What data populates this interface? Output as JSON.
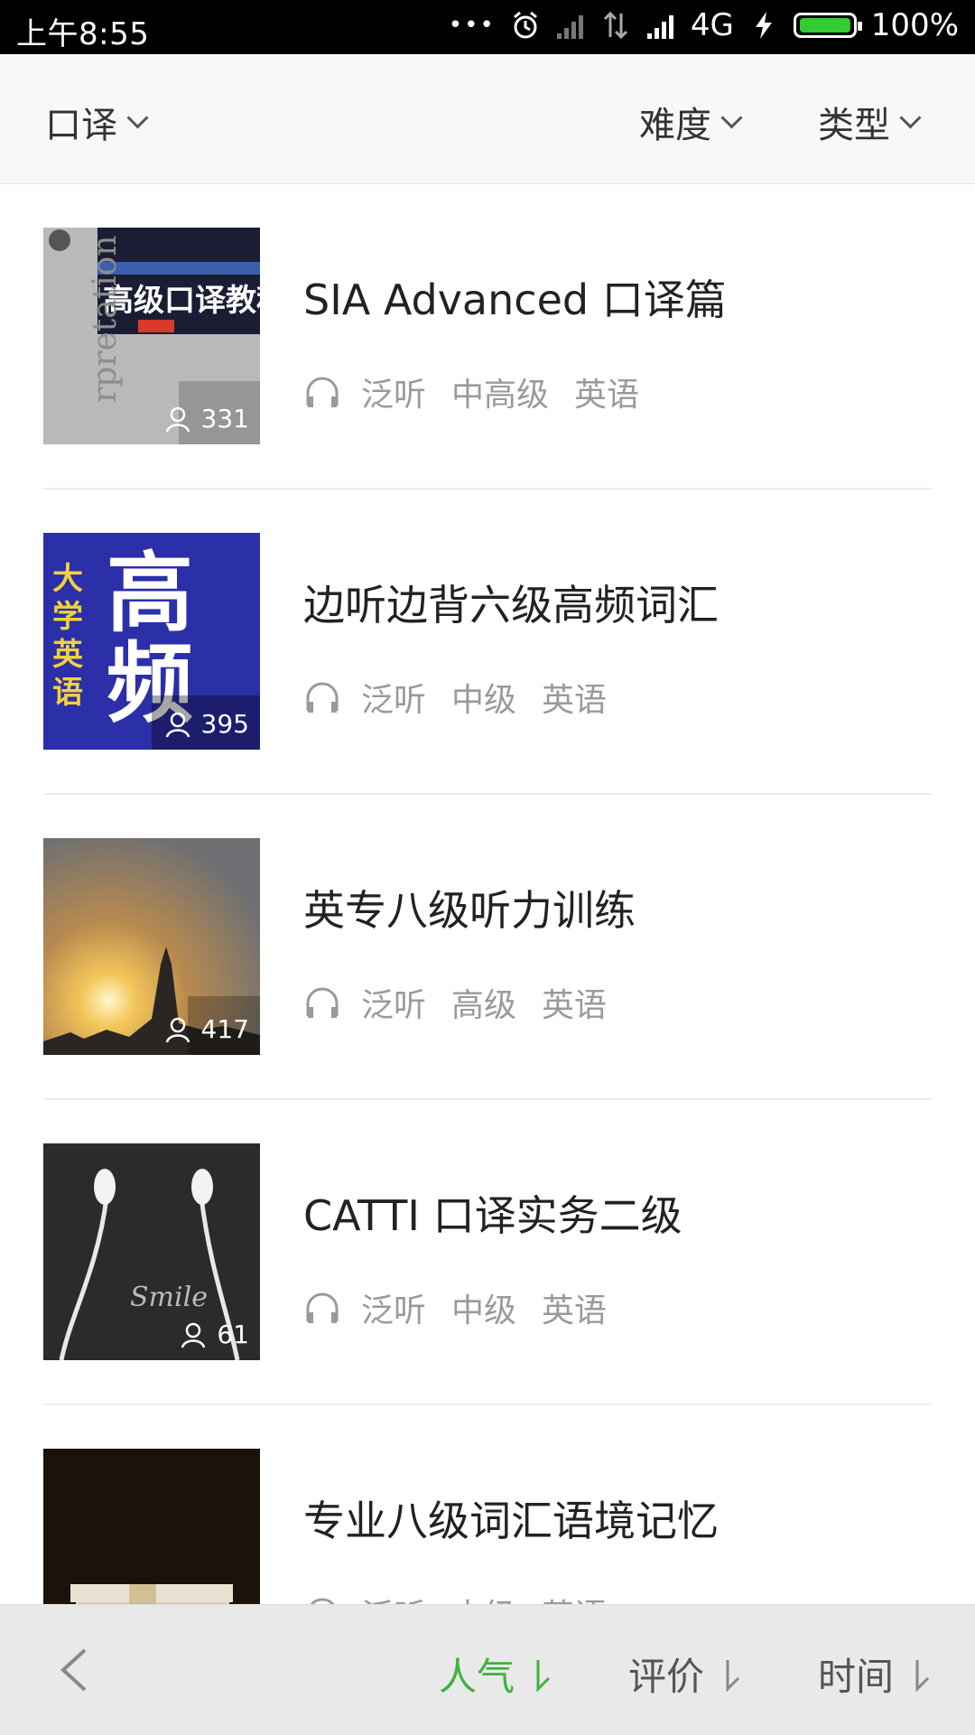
{
  "status": {
    "time": "上午8:55",
    "network": "4G",
    "battery": "100%",
    "battery_color": "#33cc33"
  },
  "filters": {
    "category": "口译",
    "difficulty": "难度",
    "type": "类型"
  },
  "items": [
    {
      "title": "SIA Advanced 口译篇",
      "count": "331",
      "tags": [
        "泛听",
        "中高级",
        "英语"
      ],
      "cover": "book-cover-advanced-interpretation"
    },
    {
      "title": "边听边背六级高频词汇",
      "count": "395",
      "tags": [
        "泛听",
        "中级",
        "英语"
      ],
      "cover": "book-cover-cet6-vocabulary"
    },
    {
      "title": "英专八级听力训练",
      "count": "417",
      "tags": [
        "泛听",
        "高级",
        "英语"
      ],
      "cover": "sunset-skyline-photo"
    },
    {
      "title": "CATTI 口译实务二级",
      "count": "61",
      "tags": [
        "泛听",
        "中级",
        "英语"
      ],
      "cover": "earphones-photo"
    },
    {
      "title": "专业八级词汇语境记忆",
      "count": "",
      "tags": [
        "泛听",
        "中级",
        "英语"
      ],
      "cover": "book-stack-photo"
    }
  ],
  "sortbar": {
    "popularity": "人气",
    "rating": "评价",
    "time": "时间",
    "active_color": "#3db33d"
  }
}
